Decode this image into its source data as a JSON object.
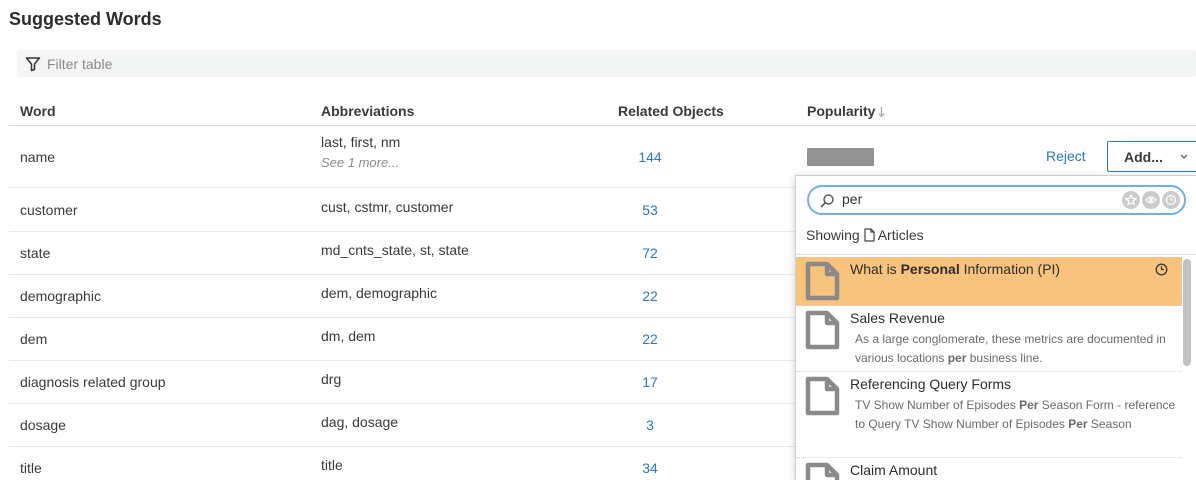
{
  "page": {
    "title": "Suggested Words"
  },
  "filter": {
    "placeholder": "Filter table"
  },
  "table": {
    "headers": {
      "word": "Word",
      "abbreviations": "Abbreviations",
      "related": "Related Objects",
      "popularity": "Popularity"
    },
    "rows": [
      {
        "word": "name",
        "abbreviations": "last, first, nm",
        "see_more": "See 1 more...",
        "related": "144",
        "popularity": 0.67
      },
      {
        "word": "customer",
        "abbreviations": "cust, cstmr, customer",
        "related": "53"
      },
      {
        "word": "state",
        "abbreviations": "md_cnts_state, st, state",
        "related": "72"
      },
      {
        "word": "demographic",
        "abbreviations": "dem, demographic",
        "related": "22"
      },
      {
        "word": "dem",
        "abbreviations": "dm, dem",
        "related": "22"
      },
      {
        "word": "diagnosis related group",
        "abbreviations": "drg",
        "related": "17"
      },
      {
        "word": "dosage",
        "abbreviations": "dag, dosage",
        "related": "3"
      },
      {
        "word": "title",
        "abbreviations": "title",
        "related": "34"
      }
    ]
  },
  "actions": {
    "reject": "Reject",
    "add": "Add..."
  },
  "dropdown": {
    "search_value": "per",
    "showing_prefix": "Showing",
    "showing_type": "Articles",
    "results": [
      {
        "pre": "What is ",
        "bold": "Personal",
        "post": " Information (PI)",
        "highlighted": true
      },
      {
        "title": "Sales Revenue",
        "desc_pre": "As a large conglomerate, these metrics are documented in various locations ",
        "desc_bold": "per",
        "desc_post": " business line."
      },
      {
        "title": "Referencing Query Forms",
        "desc_pre": "TV Show Number of Episodes ",
        "desc_bold": "Per",
        "desc_mid": " Season Form - reference to Query TV Show Number of Episodes ",
        "desc_bold2": "Per",
        "desc_post": " Season"
      },
      {
        "title": "Claim Amount"
      }
    ]
  },
  "colors": {
    "accent": "#2a78c7",
    "highlight": "#f8c37c",
    "bar": "#929292"
  }
}
